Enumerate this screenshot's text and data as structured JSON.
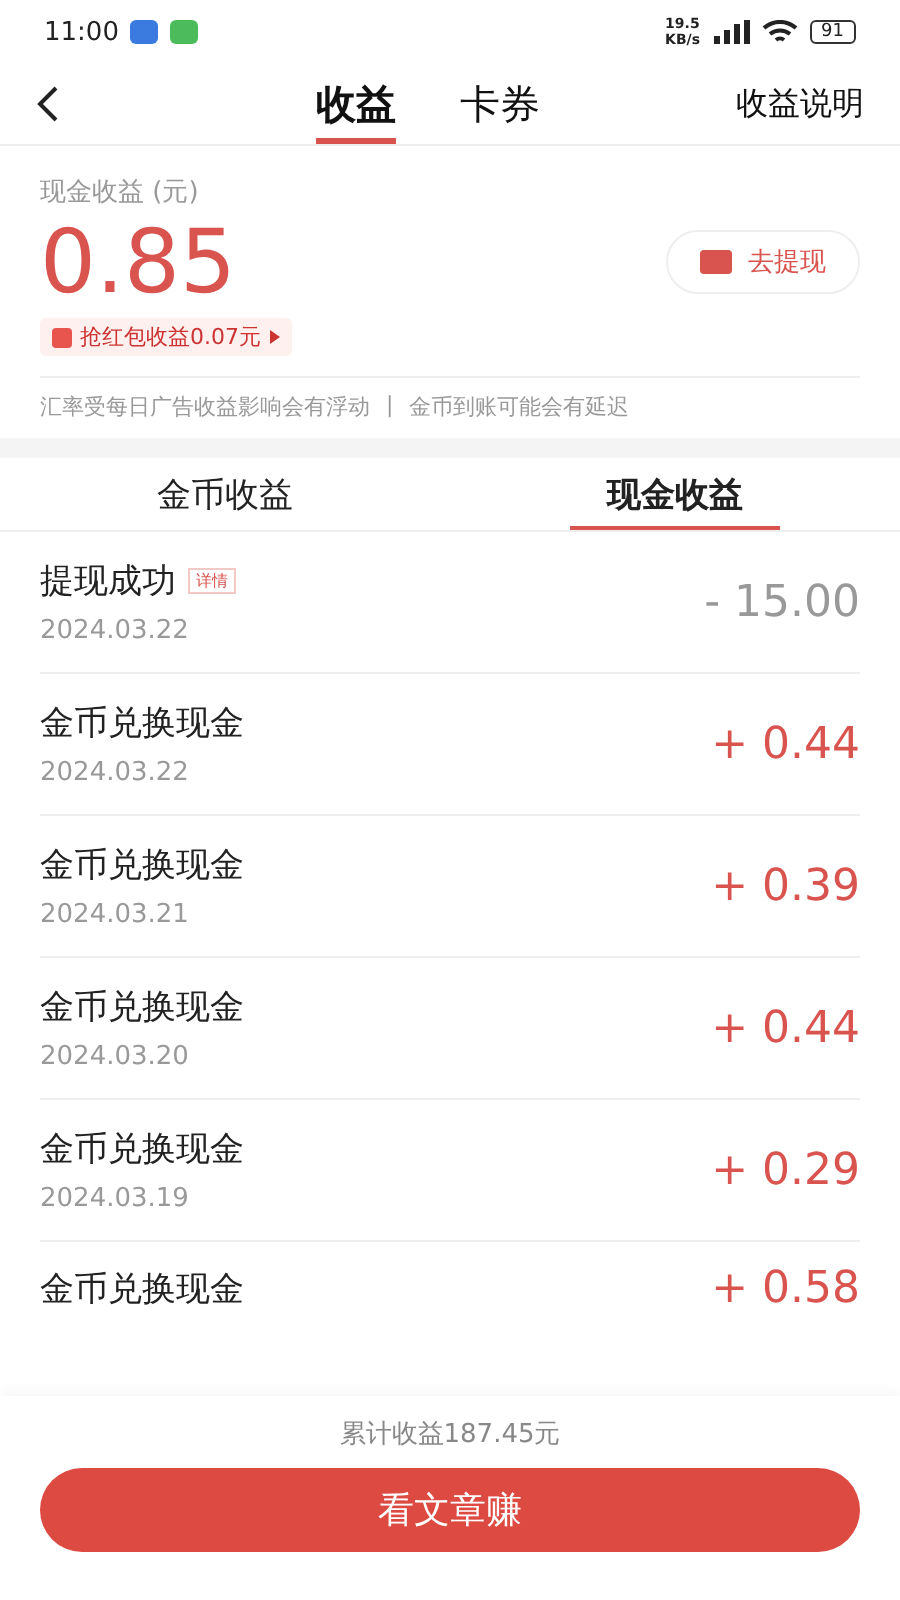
{
  "status_bar": {
    "time": "11:00",
    "speed": "19.5 KB/s",
    "battery": "91"
  },
  "header": {
    "tabs": [
      {
        "label": "收益",
        "selected": true
      },
      {
        "label": "卡券",
        "selected": false
      }
    ],
    "action": "收益说明"
  },
  "summary": {
    "label": "现金收益 (元)",
    "amount": "0.85",
    "withdraw": "去提现",
    "bonus": "抢红包收益0.07元"
  },
  "notice": {
    "items": [
      "汇率受每日广告收益影响会有浮动",
      "金币到账可能会有延迟"
    ],
    "separator": "|"
  },
  "sub_tabs": [
    {
      "label": "金币收益",
      "selected": false
    },
    {
      "label": "现金收益",
      "selected": true
    }
  ],
  "records": [
    {
      "kind": "debit",
      "title": "提现成功",
      "tag": "详情",
      "date": "2024.03.22",
      "amount": "- 15.00"
    },
    {
      "kind": "credit",
      "title": "金币兑换现金",
      "date": "2024.03.22",
      "amount": "+ 0.44"
    },
    {
      "kind": "credit",
      "title": "金币兑换现金",
      "date": "2024.03.21",
      "amount": "+ 0.39"
    },
    {
      "kind": "credit",
      "title": "金币兑换现金",
      "date": "2024.03.20",
      "amount": "+ 0.44"
    },
    {
      "kind": "credit",
      "title": "金币兑换现金",
      "date": "2024.03.19",
      "amount": "+ 0.29"
    },
    {
      "kind": "credit",
      "title": "金币兑换现金",
      "amount": "+ 0.58"
    }
  ],
  "footer": {
    "total": "累计收益187.45元",
    "button": "看文章赚"
  }
}
